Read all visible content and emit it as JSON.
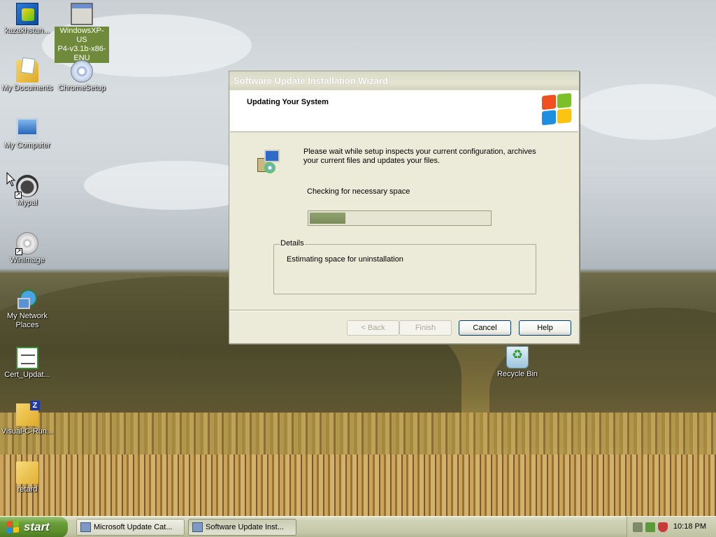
{
  "desktop": {
    "icons": [
      {
        "label": "kazakhstan...",
        "icon": "app-icon"
      },
      {
        "label": "WindowsXP-US\nP4-v3.1b-x86-\nENU",
        "icon": "window-icon"
      },
      {
        "label": "My Documents",
        "icon": "documents-folder-icon"
      },
      {
        "label": "ChromeSetup",
        "icon": "cd-setup-icon"
      },
      {
        "label": "My Computer",
        "icon": "computer-icon"
      },
      {
        "label": "Mypal",
        "icon": "raccoon-icon"
      },
      {
        "label": "WinImage",
        "icon": "disc-icon"
      },
      {
        "label": "My Network\nPlaces",
        "icon": "network-icon"
      },
      {
        "label": "Cert_Updat...",
        "icon": "certificate-icon"
      },
      {
        "label": "Visual-C-Run...",
        "icon": "zip-folder-icon"
      },
      {
        "label": "retard",
        "icon": "folder-icon"
      },
      {
        "label": "Recycle Bin",
        "icon": "recycle-bin-icon"
      }
    ]
  },
  "wizard": {
    "title": "Software Update Installation Wizard",
    "header_title": "Updating Your System",
    "message": "Please wait while setup inspects your current configuration, archives your current files and updates your files.",
    "status": "Checking for necessary space",
    "progress_fraction": 0.2,
    "details_label": "Details",
    "details_text": "Estimating space for uninstallation",
    "buttons": {
      "back": "< Back",
      "finish": "Finish",
      "cancel": "Cancel",
      "help": "Help"
    }
  },
  "taskbar": {
    "start_label": "start",
    "tasks": [
      {
        "label": "Microsoft Update Cat..."
      },
      {
        "label": "Software Update Inst..."
      }
    ],
    "clock": "10:18 PM"
  },
  "colors": {
    "progress_fill": "#8ea26f",
    "start_button": "#5b8f2c",
    "dialog_bg": "#ecead9"
  }
}
